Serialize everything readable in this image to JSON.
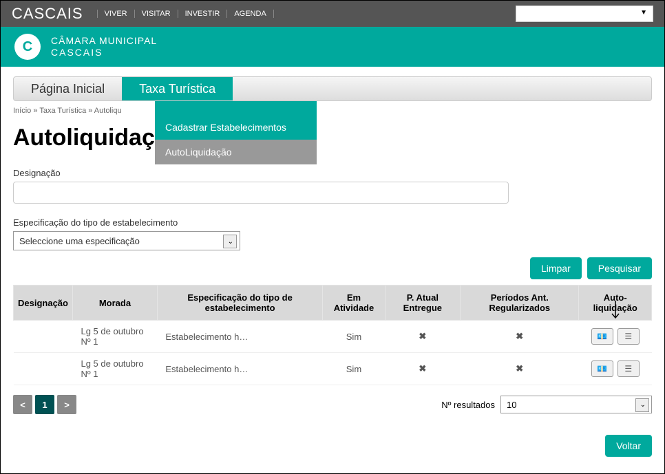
{
  "topbar": {
    "logo": "CASCAIS",
    "nav": [
      "VIVER",
      "VISITAR",
      "INVESTIR",
      "AGENDA"
    ]
  },
  "header": {
    "line1": "CÂMARA MUNICIPAL",
    "line2": "CASCAIS"
  },
  "tabs": {
    "home": "Página Inicial",
    "tax": "Taxa Turística"
  },
  "tab_menu": {
    "item1": "Cadastrar Estabelecimentos",
    "item2": "AutoLiquidação"
  },
  "breadcrumb": "Início » Taxa Turística » Autoliqu",
  "page_title": "Autoliquidaç",
  "form": {
    "designacao_label": "Designação",
    "designacao_value": "",
    "spec_label": "Especificação do tipo de estabelecimento",
    "spec_placeholder": "Seleccione uma especificação"
  },
  "buttons": {
    "limpar": "Limpar",
    "pesquisar": "Pesquisar",
    "voltar": "Voltar"
  },
  "table": {
    "headers": {
      "designacao": "Designação",
      "morada": "Morada",
      "spec": "Especificação do tipo de estabelecimento",
      "atividade": "Em Atividade",
      "entregue": "P. Atual Entregue",
      "regular": "Períodos Ant. Regularizados",
      "autoliq": "Auto-liquidação"
    },
    "rows": [
      {
        "designacao": "",
        "morada": "Lg 5 de outubro Nº 1",
        "spec": "Estabelecimento h…",
        "atividade": "Sim",
        "entregue": "✖",
        "regular": "✖"
      },
      {
        "designacao": "",
        "morada": "Lg 5 de outubro Nº 1",
        "spec": "Estabelecimento h…",
        "atividade": "Sim",
        "entregue": "✖",
        "regular": "✖"
      }
    ]
  },
  "pagination": {
    "prev": "<",
    "page": "1",
    "next": ">",
    "results_label": "Nº resultados",
    "results_value": "10"
  }
}
